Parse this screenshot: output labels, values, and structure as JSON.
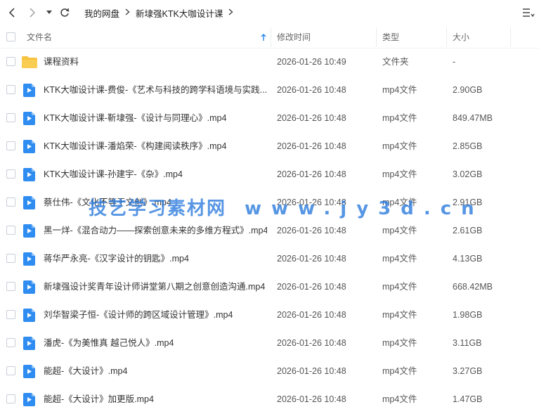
{
  "breadcrumb": [
    "我的网盘",
    "新埭强KTK大咖设计课"
  ],
  "columns": {
    "name": "文件名",
    "modified": "修改时间",
    "type": "类型",
    "size": "大小"
  },
  "files": [
    {
      "kind": "folder",
      "name": "课程资料",
      "modified": "2026-01-26 10:49",
      "type": "文件夹",
      "size": "-"
    },
    {
      "kind": "video",
      "name": "KTK大咖设计课-费俊-《艺术与科技的跨学科语境与实践...",
      "modified": "2026-01-26 10:48",
      "type": "mp4文件",
      "size": "2.90GB"
    },
    {
      "kind": "video",
      "name": "KTK大咖设计课-靳埭强-《设计与同理心》.mp4",
      "modified": "2026-01-26 10:48",
      "type": "mp4文件",
      "size": "849.47MB"
    },
    {
      "kind": "video",
      "name": "KTK大咖设计课-潘焰荣-《构建阅读秩序》.mp4",
      "modified": "2026-01-26 10:48",
      "type": "mp4文件",
      "size": "2.85GB"
    },
    {
      "kind": "video",
      "name": "KTK大咖设计课-孙建宇-《杂》.mp4",
      "modified": "2026-01-26 10:48",
      "type": "mp4文件",
      "size": "3.02GB"
    },
    {
      "kind": "video",
      "name": "蔡仕伟-《文化不等于文创》.mp4",
      "modified": "2026-01-26 10:48",
      "type": "mp4文件",
      "size": "2.91GB"
    },
    {
      "kind": "video",
      "name": "黑一烊-《混合动力——探索创意未来的多维方程式》.mp4",
      "modified": "2026-01-26 10:48",
      "type": "mp4文件",
      "size": "2.61GB"
    },
    {
      "kind": "video",
      "name": "蒋华严永亮-《汉字设计的钥匙》.mp4",
      "modified": "2026-01-26 10:48",
      "type": "mp4文件",
      "size": "4.13GB"
    },
    {
      "kind": "video",
      "name": "新埭强设计奖青年设计师讲堂第八期之创意创造沟通.mp4",
      "modified": "2026-01-26 10:48",
      "type": "mp4文件",
      "size": "668.42MB"
    },
    {
      "kind": "video",
      "name": "刘华智梁子恒-《设计师的跨区域设计管理》.mp4",
      "modified": "2026-01-26 10:48",
      "type": "mp4文件",
      "size": "1.98GB"
    },
    {
      "kind": "video",
      "name": "潘虎-《为美惟真 越己悦人》.mp4",
      "modified": "2026-01-26 10:48",
      "type": "mp4文件",
      "size": "3.11GB"
    },
    {
      "kind": "video",
      "name": "能超-《大设计》.mp4",
      "modified": "2026-01-26 10:48",
      "type": "mp4文件",
      "size": "3.27GB"
    },
    {
      "kind": "video",
      "name": "能超-《大设计》加更版.mp4",
      "modified": "2026-01-26 10:48",
      "type": "mp4文件",
      "size": "1.47GB"
    }
  ],
  "watermark": {
    "text": "技艺学习素材网",
    "url": "www.jy3d.cn"
  },
  "colors": {
    "accent": "#2f8cf0",
    "folder": "#f6c342",
    "header_text": "#666666"
  },
  "icons": {
    "back": "chevron-left-icon",
    "forward": "chevron-right-icon",
    "dropdown": "caret-down-icon",
    "refresh": "refresh-icon",
    "view": "list-sort-icon",
    "sort": "arrow-up-icon"
  }
}
